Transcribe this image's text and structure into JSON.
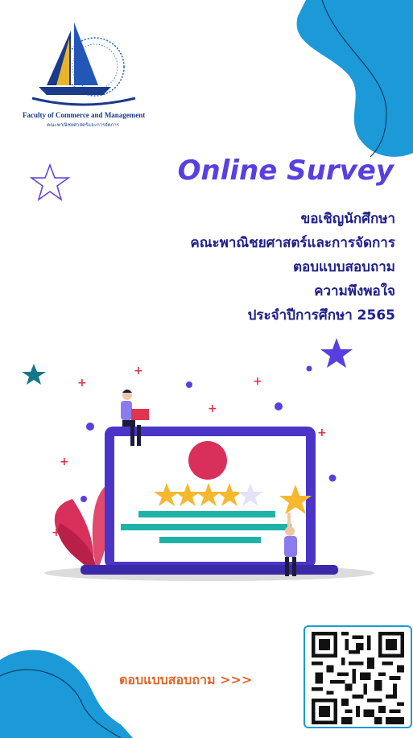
{
  "logo": {
    "name_en": "Faculty of Commerce and Management",
    "name_th": "คณะพาณิชยศาสตร์และการจัดการ"
  },
  "headline": {
    "title": "Online Survey",
    "lines": [
      "ขอเชิญนักศึกษา",
      "คณะพาณิชยศาสตร์และการจัดการ",
      "ตอบแบบสอบถาม",
      "ความพึงพอใจ",
      "ประจำปีการศึกษา 2565"
    ]
  },
  "illustration": {
    "rating_stars_filled": 4,
    "rating_stars_total": 5
  },
  "cta": {
    "label": "ตอบแบบสอบถาม >>>"
  },
  "icons": {
    "qr": "qr-code-icon",
    "star": "star-icon"
  },
  "colors": {
    "title": "#5a3fe0",
    "body_text": "#1f1f8f",
    "cta": "#e0662a",
    "blob": "#1c9ad8",
    "laptop": "#4a35c8",
    "star_gold": "#f5b82e"
  }
}
